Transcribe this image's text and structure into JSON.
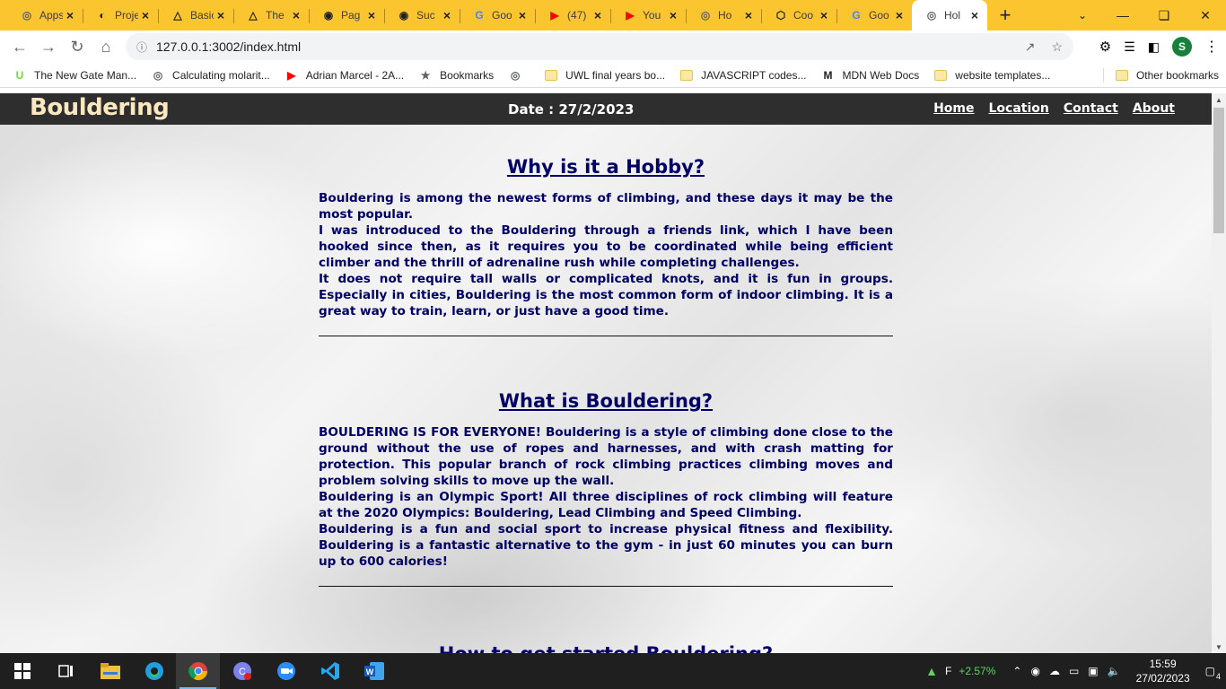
{
  "tabs": [
    {
      "title": "Apps",
      "icon": "globe-icon"
    },
    {
      "title": "Projects",
      "icon": "contrast-icon"
    },
    {
      "title": "Basic",
      "icon": "angular-icon"
    },
    {
      "title": "The",
      "icon": "angular-icon"
    },
    {
      "title": "Pag",
      "icon": "github-icon"
    },
    {
      "title": "Suc",
      "icon": "github-icon"
    },
    {
      "title": "Goo",
      "icon": "google-icon"
    },
    {
      "title": "(47)",
      "icon": "youtube-icon"
    },
    {
      "title": "You",
      "icon": "youtube-icon"
    },
    {
      "title": "Ho",
      "icon": "globe-icon"
    },
    {
      "title": "Coo",
      "icon": "codepen-icon"
    },
    {
      "title": "Goo",
      "icon": "google-icon"
    },
    {
      "title": "Hol",
      "icon": "globe-icon",
      "active": true
    }
  ],
  "toolbar": {
    "url": "127.0.0.1:3002/index.html",
    "profile_initial": "S"
  },
  "bookmarks": [
    {
      "label": "The New Gate Man...",
      "icon": "upwork-icon"
    },
    {
      "label": "Calculating molarit...",
      "icon": "globe-icon"
    },
    {
      "label": "Adrian Marcel - 2A...",
      "icon": "youtube-icon"
    },
    {
      "label": "Bookmarks",
      "icon": "star-icon"
    },
    {
      "label": "",
      "icon": "globe-icon"
    },
    {
      "label": "UWL final years bo...",
      "icon": "folder-icon"
    },
    {
      "label": "JAVASCRIPT codes...",
      "icon": "folder-icon"
    },
    {
      "label": "MDN Web Docs",
      "icon": "mdn-icon"
    },
    {
      "label": "website templates...",
      "icon": "folder-icon"
    }
  ],
  "other_bookmarks": "Other bookmarks",
  "site": {
    "brand": "Bouldering",
    "date": "Date : 27/2/2023",
    "nav": [
      "Home",
      "Location",
      "Contact",
      "About"
    ]
  },
  "sections": [
    {
      "title": "Why is it a Hobby?",
      "paragraphs": [
        "Bouldering is among the newest forms of climbing, and these days it may be the most popular.",
        "I was introduced to the Bouldering through a friends link, which I have been hooked since then, as it requires you to be coordinated while being efficient climber and the thrill of adrenaline rush while completing challenges.",
        "It does not require tall walls or complicated knots, and it is fun in groups. Especially in cities, Bouldering is the most common form of indoor climbing. It is a great way to train, learn, or just have a good time."
      ]
    },
    {
      "title": "What is Bouldering?",
      "paragraphs": [
        "BOULDERING IS FOR EVERYONE! Bouldering is a style of climbing done close to the ground without the use of ropes and harnesses, and with crash matting for protection. This popular branch of rock climbing practices climbing moves and problem solving skills to move up the wall.",
        "Bouldering is an Olympic Sport! All three disciplines of rock climbing will feature at the 2020 Olympics: Bouldering, Lead Climbing and Speed Climbing.",
        "Bouldering is a fun and social sport to increase physical fitness and flexibility. Bouldering is a fantastic alternative to the gym - in just 60 minutes you can burn up to 600 calories!"
      ]
    },
    {
      "title": "How to get started Bouldering?",
      "paragraphs": []
    }
  ],
  "taskbar": {
    "stock_label": "F",
    "stock_change": "+2.57%",
    "time": "15:59",
    "date": "27/02/2023",
    "notifications": "4",
    "apps": [
      "start-icon",
      "task-view-icon",
      "file-explorer-icon",
      "edge-icon",
      "chrome-icon",
      "teams-icon",
      "zoom-icon",
      "vscode-icon",
      "word-icon"
    ]
  }
}
